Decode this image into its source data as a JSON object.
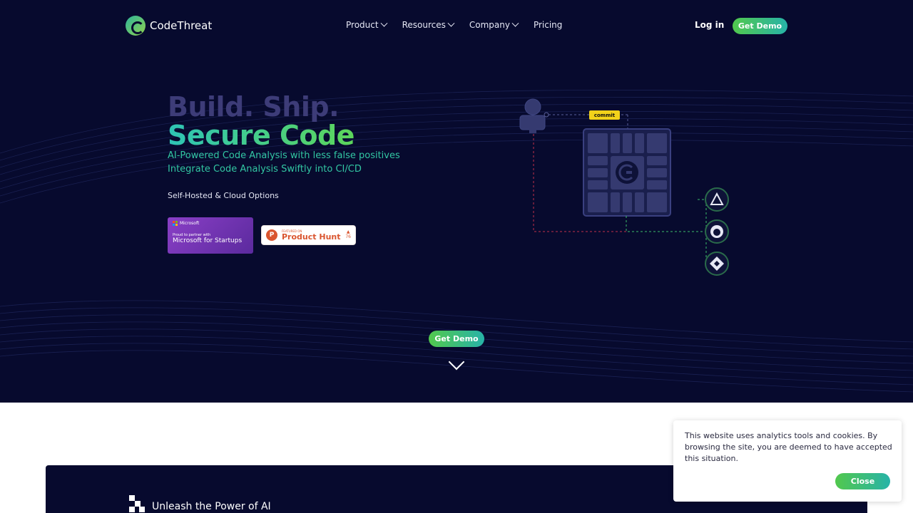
{
  "brand": {
    "name": "CodeThreat"
  },
  "nav": {
    "items": [
      {
        "label": "Product",
        "dropdown": true
      },
      {
        "label": "Resources",
        "dropdown": true
      },
      {
        "label": "Company",
        "dropdown": true
      },
      {
        "label": "Pricing",
        "dropdown": false
      }
    ],
    "login_label": "Log in",
    "demo_label": "Get Demo"
  },
  "hero": {
    "headline_1": "Build. Ship.",
    "headline_2": "Secure Code",
    "subline_1": "AI-Powered Code Analysis with less false positives",
    "subline_2": "Integrate Code Analysis Swiftly into CI/CD",
    "options": "Self-Hosted & Cloud Options",
    "cta_label": "Get Demo",
    "microsoft_badge": {
      "brand": "Microsoft",
      "line1": "Proud to partner with",
      "line2": "Microsoft for Startups"
    },
    "producthunt_badge": {
      "letter": "P",
      "small": "FEATURED ON",
      "name": "Product Hunt",
      "votes": "76"
    },
    "diagram": {
      "commit_label": "commit"
    }
  },
  "section2": {
    "title": "Unleash the Power of AI"
  },
  "cookie": {
    "text": "This website uses analytics tools and cookies. By browsing the site, you are deemed to have accepted this situation.",
    "close_label": "Close"
  },
  "colors": {
    "hero_bg": "#070a2e",
    "accent_green": "#52c84d",
    "accent_teal": "#27b3a8",
    "headline_muted": "#3d3c78",
    "subline": "#32c7a3"
  }
}
